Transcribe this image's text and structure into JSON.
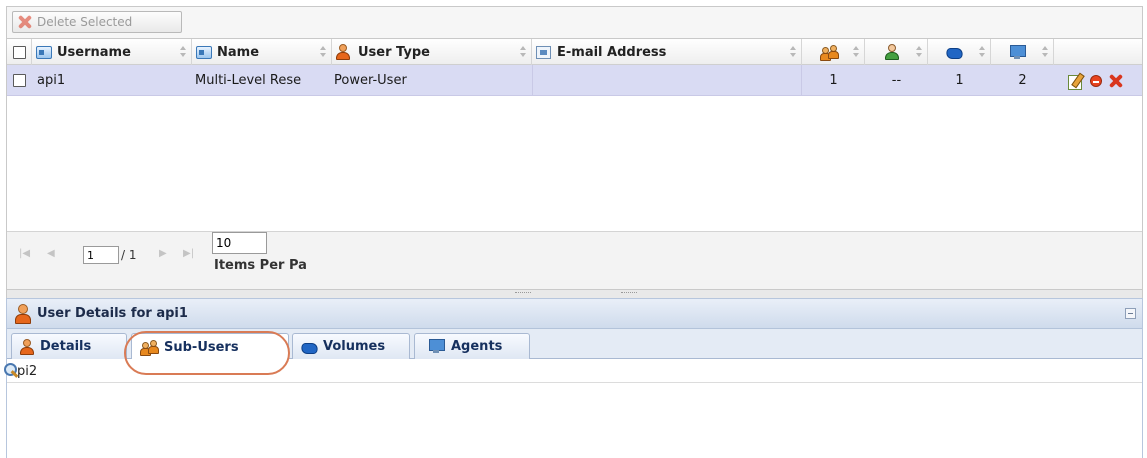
{
  "toolbar": {
    "delete_label": "Delete Selected"
  },
  "grid": {
    "columns": {
      "username": "Username",
      "name": "Name",
      "user_type": "User Type",
      "email": "E-mail Address"
    },
    "icon_columns": [
      "users-icon",
      "person-green-icon",
      "volume-icon",
      "monitor-icon"
    ],
    "rows": [
      {
        "username": "api1",
        "name": "Multi-Level Rese",
        "user_type": "Power-User",
        "email": "",
        "sub_users": "1",
        "owners": "--",
        "volumes": "1",
        "agents": "2"
      }
    ],
    "row_actions": [
      "edit-icon",
      "disable-icon",
      "delete-icon"
    ]
  },
  "pager": {
    "page": "1",
    "total": "/ 1",
    "per_page": "10",
    "per_page_label": "Items Per Pa"
  },
  "details": {
    "title": "User Details for api1",
    "tabs": [
      "Details",
      "Sub-Users",
      "Volumes",
      "Agents"
    ],
    "active_tab": "Sub-Users",
    "filter_value": "api2"
  },
  "colors": {
    "selected_row": "#d9dbf3",
    "panel_header": "#cfdbec",
    "highlight_ring": "#d97b55",
    "delete_red": "#d9361e"
  }
}
